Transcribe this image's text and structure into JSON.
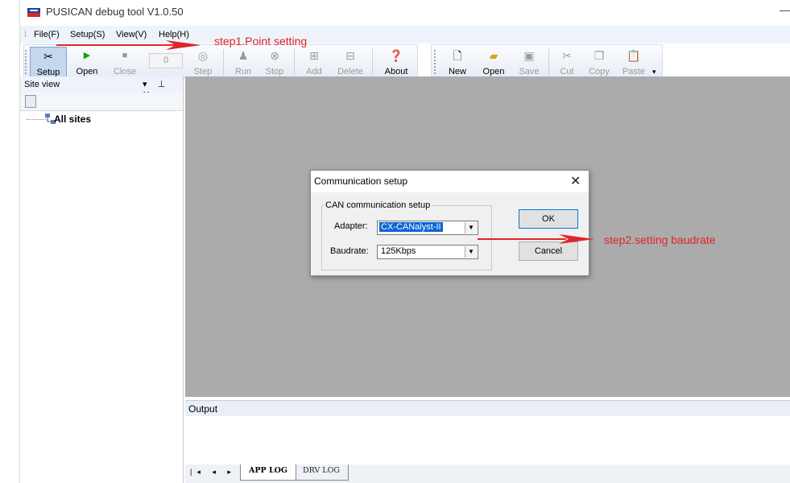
{
  "window": {
    "title": "PUSICAN debug tool V1.0.50",
    "minimize": "—"
  },
  "menu": [
    {
      "label": "File(F)"
    },
    {
      "label": "Setup(S)"
    },
    {
      "label": "View(V)"
    },
    {
      "label": "Help(H)"
    }
  ],
  "toolbar": {
    "setup": "Setup",
    "open": "Open",
    "close": "Close",
    "counter": "0",
    "step": "Step",
    "run": "Run",
    "stop": "Stop",
    "add": "Add",
    "delete": "Delete",
    "about": "About"
  },
  "filebar": {
    "new": "New",
    "open": "Open",
    "save": "Save",
    "cut": "Cut",
    "copy": "Copy",
    "paste": "Paste"
  },
  "siteview": {
    "title": "Site view",
    "controls": "▾ ⊥ ✕",
    "root": "All sites"
  },
  "output": {
    "title": "Output",
    "tab_nav": "|◂ ◂ ▸ ▸|",
    "tabs": [
      "APP LOG",
      "DRV LOG"
    ]
  },
  "dialog": {
    "title": "Communication setup",
    "close": "✕",
    "group": "CAN communication setup",
    "adapter_label": "Adapter:",
    "adapter_value": "CX-CANalyst-II",
    "baudrate_label": "Baudrate:",
    "baudrate_value": "125Kbps",
    "ok": "OK",
    "cancel": "Cancel"
  },
  "annotations": {
    "step1": "step1.Point setting",
    "step2": "step2.setting baudrate"
  },
  "colors": {
    "annotation": "#e0242a",
    "selection": "#0a64d6",
    "mdi_background": "#ababab"
  }
}
